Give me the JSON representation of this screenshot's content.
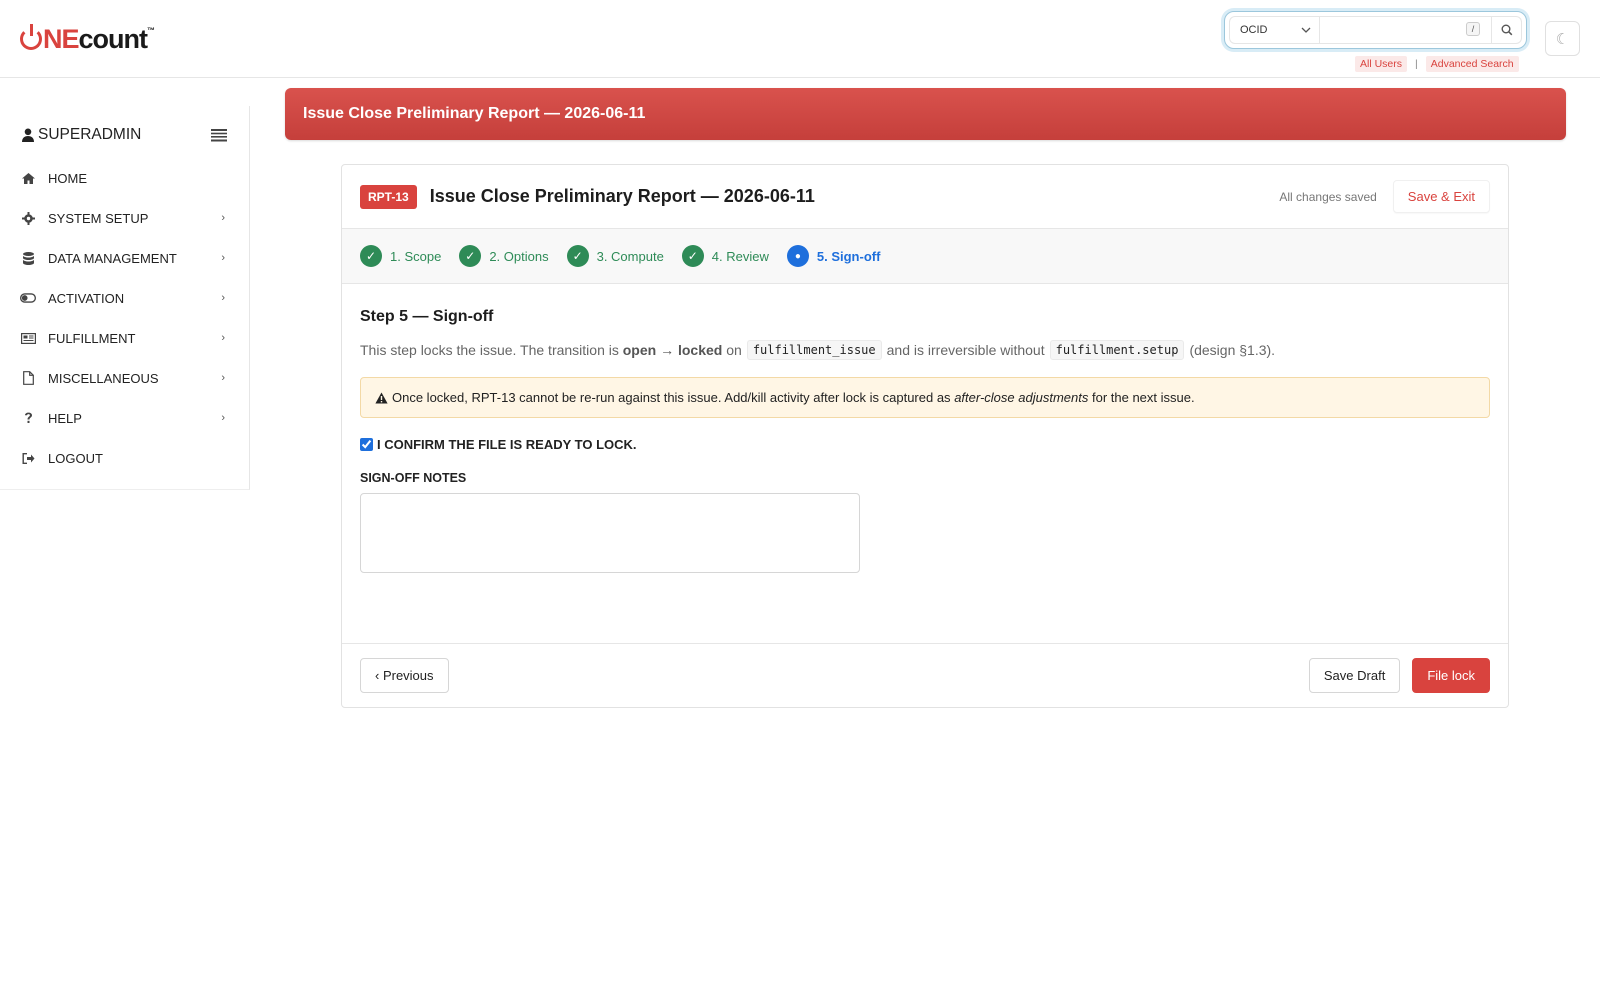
{
  "brand": {
    "logo_prefix": "NE",
    "logo_suffix": "count",
    "logo_tm": "™",
    "accent": "#d9433e"
  },
  "search": {
    "scope_value": "OCID",
    "shortcut": "/",
    "placeholder": "",
    "links": [
      "All Users",
      "Advanced Search"
    ],
    "separator": "|"
  },
  "theme_toggle": {
    "glyph": "☾"
  },
  "sidebar": {
    "user": "SUPERADMIN",
    "items": [
      {
        "label": "HOME",
        "icon": "home-icon",
        "has_children": false
      },
      {
        "label": "SYSTEM SETUP",
        "icon": "gear-icon",
        "has_children": true
      },
      {
        "label": "DATA MANAGEMENT",
        "icon": "database-icon",
        "has_children": true
      },
      {
        "label": "ACTIVATION",
        "icon": "toggle-icon",
        "has_children": true
      },
      {
        "label": "FULFILLMENT",
        "icon": "newspaper-icon",
        "has_children": true
      },
      {
        "label": "MISCELLANEOUS",
        "icon": "file-icon",
        "has_children": true
      },
      {
        "label": "HELP",
        "icon": "question-icon",
        "has_children": true
      },
      {
        "label": "LOGOUT",
        "icon": "sign-out-icon",
        "has_children": false
      }
    ],
    "chevron": "›"
  },
  "banner": {
    "title": "Issue Close Preliminary Report — 2026-06-11"
  },
  "card": {
    "badge": "RPT-13",
    "title": "Issue Close Preliminary Report — 2026-06-11",
    "status": "All changes saved",
    "save_exit": "Save & Exit"
  },
  "steps": [
    {
      "label": "1. Scope",
      "state": "done",
      "mark": "✓"
    },
    {
      "label": "2. Options",
      "state": "done",
      "mark": "✓"
    },
    {
      "label": "3. Compute",
      "state": "done",
      "mark": "✓"
    },
    {
      "label": "4. Review",
      "state": "done",
      "mark": "✓"
    },
    {
      "label": "5. Sign-off",
      "state": "active",
      "mark": "●"
    }
  ],
  "step_body": {
    "heading": "Step 5 — Sign-off",
    "desc_1": "This step locks the issue. The transition is",
    "desc_open": "open",
    "desc_arrow": "→",
    "desc_locked": "locked",
    "desc_on": "on",
    "code_1": "fulfillment_issue",
    "desc_2": "and is irreversible without",
    "code_2": "fulfillment.setup",
    "desc_3": "(design §1.3).",
    "warning_1": "Once locked, RPT-13 cannot be re-run against this issue. Add/kill activity after lock is captured as",
    "warning_em": "after-close adjustments",
    "warning_2": "for the next issue.",
    "confirm_label": "I CONFIRM THE FILE IS READY TO LOCK.",
    "confirm_checked": true,
    "notes_label": "SIGN-OFF NOTES",
    "notes_value": ""
  },
  "footer": {
    "previous": "‹ Previous",
    "save_draft": "Save Draft",
    "file_lock": "File lock"
  }
}
